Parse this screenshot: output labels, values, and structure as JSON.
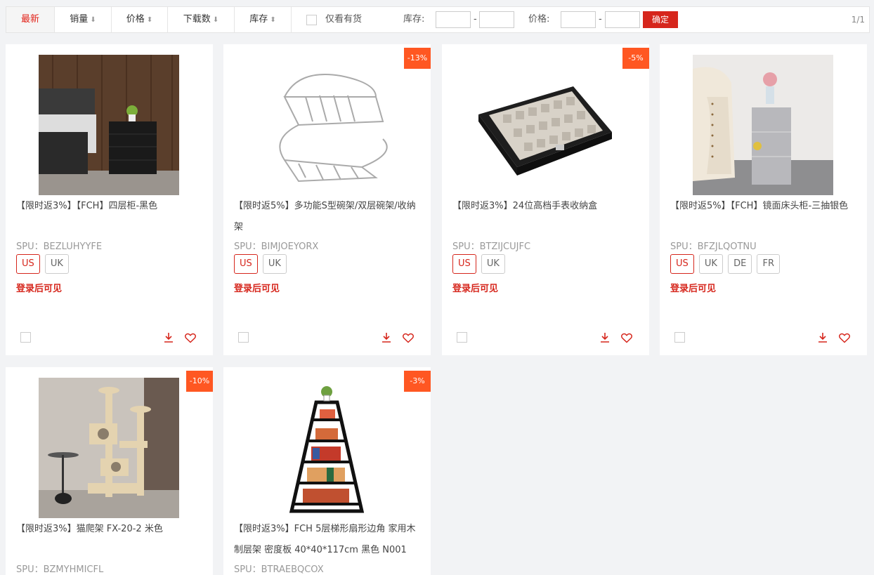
{
  "toolbar": {
    "sort_latest": "最新",
    "sort_sales": "销量",
    "sort_price": "价格",
    "sort_downloads": "下载数",
    "sort_stock": "库存",
    "in_stock_only": "仅看有货",
    "stock_label": "库存:",
    "price_label": "价格:",
    "dash": "-",
    "confirm": "确定",
    "pager": "1/1"
  },
  "products": [
    {
      "title": "【限时返3%】【FCH】四层柜-黑色",
      "spu": "SPU：BEZLUHYYFE",
      "tags": [
        "US",
        "UK"
      ],
      "login_text": "登录后可见",
      "discount": ""
    },
    {
      "title": "【限时返5%】多功能S型碗架/双层碗架/收纳架",
      "spu": "SPU：BIMJOEYORX",
      "tags": [
        "US",
        "UK"
      ],
      "login_text": "登录后可见",
      "discount": "-13%"
    },
    {
      "title": "【限时返3%】24位高档手表收纳盒",
      "spu": "SPU：BTZIJCUJFC",
      "tags": [
        "US",
        "UK"
      ],
      "login_text": "登录后可见",
      "discount": "-5%"
    },
    {
      "title": "【限时返5%】【FCH】镜面床头柜-三抽银色",
      "spu": "SPU：BFZJLQOTNU",
      "tags": [
        "US",
        "UK",
        "DE",
        "FR"
      ],
      "login_text": "登录后可见",
      "discount": ""
    },
    {
      "title": "【限时返3%】猫爬架 FX-20-2 米色",
      "spu": "SPU：BZMYHMICFL",
      "tags": [],
      "login_text": "",
      "discount": "-10%"
    },
    {
      "title": "【限时返3%】FCH 5层梯形扇形边角 家用木制层架 密度板 40*40*117cm 黑色 N001",
      "spu": "SPU：BTRAEBQCOX",
      "tags": [],
      "login_text": "",
      "discount": "-3%"
    }
  ]
}
